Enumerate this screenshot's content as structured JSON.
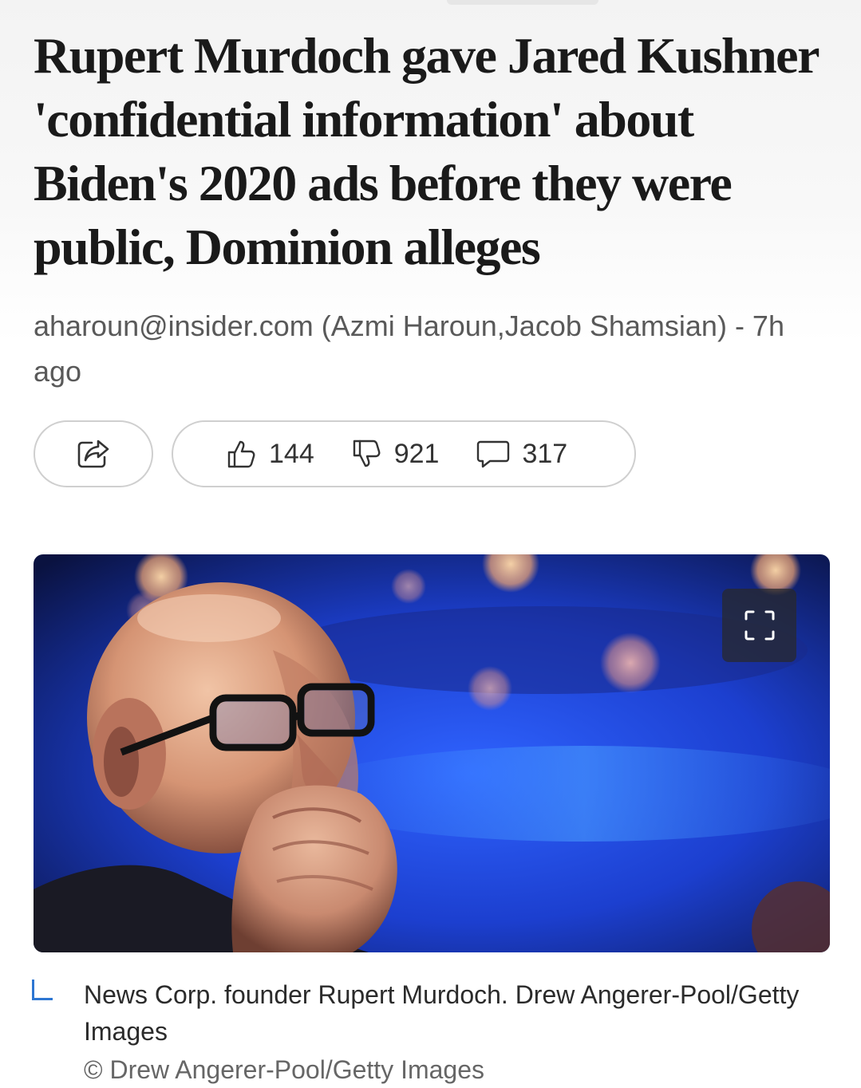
{
  "article": {
    "headline": "Rupert Murdoch gave Jared Kushner 'confidential information' about Biden's 2020 ads before they were public, Dominion alleges",
    "byline": "aharoun@insider.com (Azmi Haroun,Jacob Shamsian) - 7h ago"
  },
  "actions": {
    "share_icon": "share-icon",
    "like_icon": "thumbs-up-icon",
    "like_count": "144",
    "dislike_icon": "thumbs-down-icon",
    "dislike_count": "921",
    "comment_icon": "comment-icon",
    "comment_count": "317"
  },
  "image": {
    "expand_icon": "expand-icon",
    "caption": "News Corp. founder Rupert Murdoch. Drew Angerer-Pool/Getty Images",
    "credit": "© Drew Angerer-Pool/Getty Images"
  },
  "colors": {
    "accent": "#2d76d2",
    "headline": "#1a1a1a",
    "byline": "#595959",
    "photo_background": "#1e3fc8"
  }
}
